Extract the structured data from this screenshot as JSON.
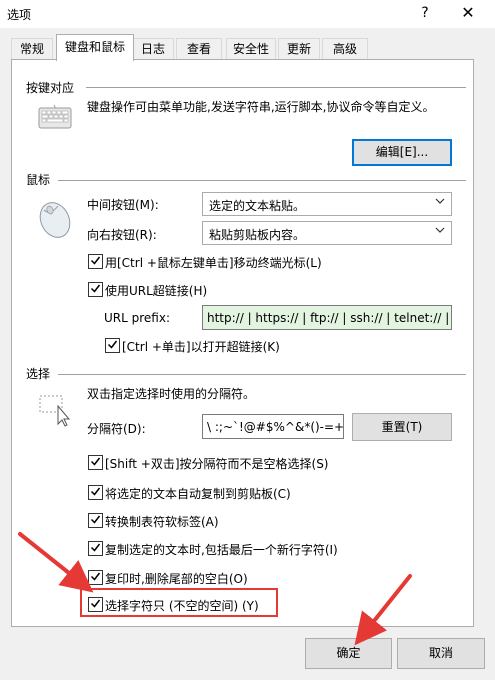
{
  "window": {
    "title": "选项",
    "help_glyph": "?",
    "close_glyph": "✕"
  },
  "tabs": [
    {
      "label": "常规",
      "active": false
    },
    {
      "label": "键盘和鼠标",
      "active": true
    },
    {
      "label": "日志",
      "active": false
    },
    {
      "label": "查看",
      "active": false
    },
    {
      "label": "安全性",
      "active": false
    },
    {
      "label": "更新",
      "active": false
    },
    {
      "label": "高级",
      "active": false
    }
  ],
  "keyboard_section": {
    "label": "按键对应",
    "description": "键盘操作可由菜单功能,发送字符串,运行脚本,协议命令等自定义。",
    "edit_button": "编辑[E]..."
  },
  "mouse_section": {
    "label": "鼠标",
    "middle_button_label": "中间按钮(M):",
    "middle_button_value": "选定的文本粘贴。",
    "right_button_label": "向右按钮(R):",
    "right_button_value": "粘贴剪贴板内容。",
    "ctrl_click_move": {
      "label": "用[Ctrl +鼠标左键单击]移动终端光标(L)",
      "checked": true
    },
    "use_url_hyperlink": {
      "label": "使用URL超链接(H)",
      "checked": true
    },
    "url_prefix_label": "URL prefix:",
    "url_prefix_value": "http:// | https:// | ftp:// | ssh:// | telnet:// |",
    "ctrl_click_open": {
      "label": "[Ctrl +单击]以打开超链接(K)",
      "checked": true
    }
  },
  "selection_section": {
    "label": "选择",
    "description": "双击指定选择时使用的分隔符。",
    "delimiter_label": "分隔符(D):",
    "delimiter_value": "\\ :;~`!@#$%^&*()-=+|[",
    "reset_button": "重置(T)",
    "options": [
      {
        "label": "[Shift +双击]按分隔符而不是空格选择(S)",
        "checked": true
      },
      {
        "label": "将选定的文本自动复制到剪贴板(C)",
        "checked": true
      },
      {
        "label": "转换制表符软标签(A)",
        "checked": true
      },
      {
        "label": "复制选定的文本时,包括最后一个新行字符(I)",
        "checked": true
      },
      {
        "label": "复印时,删除尾部的空白(O)",
        "checked": true
      },
      {
        "label": "选择字符只 (不空的空间) (Y)",
        "checked": true
      }
    ]
  },
  "footer": {
    "ok_button": "确定",
    "cancel_button": "取消"
  },
  "colors": {
    "annotation_red": "#e53935",
    "url_field_bg": "#e3f4e1",
    "focus_blue": "#0078d7"
  }
}
